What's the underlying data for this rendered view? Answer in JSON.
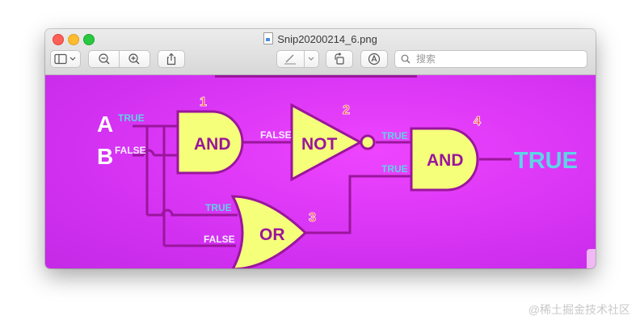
{
  "window": {
    "filename": "Snip20200214_6.png"
  },
  "toolbar": {
    "search_placeholder": "搜索"
  },
  "diagram": {
    "inputs": {
      "a": "A",
      "b": "B"
    },
    "gate_numbers": {
      "g1": "1",
      "g2": "2",
      "g3": "3",
      "g4": "4"
    },
    "gate_labels": {
      "g1": "AND",
      "g2": "NOT",
      "g3": "OR",
      "g4": "AND"
    },
    "signal_labels": {
      "a_in": "TRUE",
      "b_in": "FALSE",
      "and1_out": "FALSE",
      "not_out": "TRUE",
      "or_to_and": "TRUE",
      "or_in_a": "TRUE",
      "or_in_b": "FALSE"
    },
    "output": "TRUE"
  },
  "watermark": "@稀土掘金技术社区",
  "colors": {
    "background": "#d63cf5",
    "gate_fill": "#f5ff7a",
    "wire": "#9a169c",
    "gate_number": "#ff2a2a",
    "true_text": "#5fd4e6",
    "false_text": "#f5f0ff"
  }
}
